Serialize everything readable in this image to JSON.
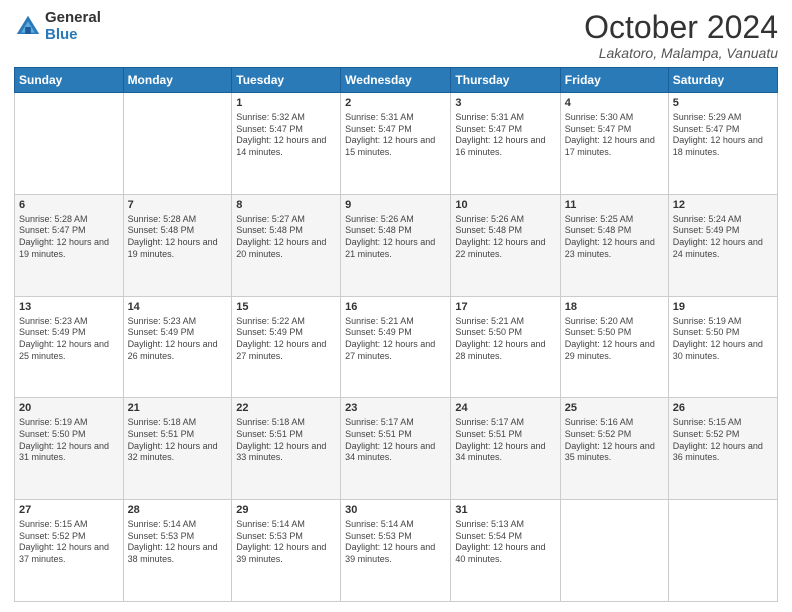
{
  "logo": {
    "general": "General",
    "blue": "Blue"
  },
  "title": "October 2024",
  "subtitle": "Lakatoro, Malampa, Vanuatu",
  "days_header": [
    "Sunday",
    "Monday",
    "Tuesday",
    "Wednesday",
    "Thursday",
    "Friday",
    "Saturday"
  ],
  "weeks": [
    [
      {
        "day": "",
        "sunrise": "",
        "sunset": "",
        "daylight": ""
      },
      {
        "day": "",
        "sunrise": "",
        "sunset": "",
        "daylight": ""
      },
      {
        "day": "1",
        "sunrise": "Sunrise: 5:32 AM",
        "sunset": "Sunset: 5:47 PM",
        "daylight": "Daylight: 12 hours and 14 minutes."
      },
      {
        "day": "2",
        "sunrise": "Sunrise: 5:31 AM",
        "sunset": "Sunset: 5:47 PM",
        "daylight": "Daylight: 12 hours and 15 minutes."
      },
      {
        "day": "3",
        "sunrise": "Sunrise: 5:31 AM",
        "sunset": "Sunset: 5:47 PM",
        "daylight": "Daylight: 12 hours and 16 minutes."
      },
      {
        "day": "4",
        "sunrise": "Sunrise: 5:30 AM",
        "sunset": "Sunset: 5:47 PM",
        "daylight": "Daylight: 12 hours and 17 minutes."
      },
      {
        "day": "5",
        "sunrise": "Sunrise: 5:29 AM",
        "sunset": "Sunset: 5:47 PM",
        "daylight": "Daylight: 12 hours and 18 minutes."
      }
    ],
    [
      {
        "day": "6",
        "sunrise": "Sunrise: 5:28 AM",
        "sunset": "Sunset: 5:47 PM",
        "daylight": "Daylight: 12 hours and 19 minutes."
      },
      {
        "day": "7",
        "sunrise": "Sunrise: 5:28 AM",
        "sunset": "Sunset: 5:48 PM",
        "daylight": "Daylight: 12 hours and 19 minutes."
      },
      {
        "day": "8",
        "sunrise": "Sunrise: 5:27 AM",
        "sunset": "Sunset: 5:48 PM",
        "daylight": "Daylight: 12 hours and 20 minutes."
      },
      {
        "day": "9",
        "sunrise": "Sunrise: 5:26 AM",
        "sunset": "Sunset: 5:48 PM",
        "daylight": "Daylight: 12 hours and 21 minutes."
      },
      {
        "day": "10",
        "sunrise": "Sunrise: 5:26 AM",
        "sunset": "Sunset: 5:48 PM",
        "daylight": "Daylight: 12 hours and 22 minutes."
      },
      {
        "day": "11",
        "sunrise": "Sunrise: 5:25 AM",
        "sunset": "Sunset: 5:48 PM",
        "daylight": "Daylight: 12 hours and 23 minutes."
      },
      {
        "day": "12",
        "sunrise": "Sunrise: 5:24 AM",
        "sunset": "Sunset: 5:49 PM",
        "daylight": "Daylight: 12 hours and 24 minutes."
      }
    ],
    [
      {
        "day": "13",
        "sunrise": "Sunrise: 5:23 AM",
        "sunset": "Sunset: 5:49 PM",
        "daylight": "Daylight: 12 hours and 25 minutes."
      },
      {
        "day": "14",
        "sunrise": "Sunrise: 5:23 AM",
        "sunset": "Sunset: 5:49 PM",
        "daylight": "Daylight: 12 hours and 26 minutes."
      },
      {
        "day": "15",
        "sunrise": "Sunrise: 5:22 AM",
        "sunset": "Sunset: 5:49 PM",
        "daylight": "Daylight: 12 hours and 27 minutes."
      },
      {
        "day": "16",
        "sunrise": "Sunrise: 5:21 AM",
        "sunset": "Sunset: 5:49 PM",
        "daylight": "Daylight: 12 hours and 27 minutes."
      },
      {
        "day": "17",
        "sunrise": "Sunrise: 5:21 AM",
        "sunset": "Sunset: 5:50 PM",
        "daylight": "Daylight: 12 hours and 28 minutes."
      },
      {
        "day": "18",
        "sunrise": "Sunrise: 5:20 AM",
        "sunset": "Sunset: 5:50 PM",
        "daylight": "Daylight: 12 hours and 29 minutes."
      },
      {
        "day": "19",
        "sunrise": "Sunrise: 5:19 AM",
        "sunset": "Sunset: 5:50 PM",
        "daylight": "Daylight: 12 hours and 30 minutes."
      }
    ],
    [
      {
        "day": "20",
        "sunrise": "Sunrise: 5:19 AM",
        "sunset": "Sunset: 5:50 PM",
        "daylight": "Daylight: 12 hours and 31 minutes."
      },
      {
        "day": "21",
        "sunrise": "Sunrise: 5:18 AM",
        "sunset": "Sunset: 5:51 PM",
        "daylight": "Daylight: 12 hours and 32 minutes."
      },
      {
        "day": "22",
        "sunrise": "Sunrise: 5:18 AM",
        "sunset": "Sunset: 5:51 PM",
        "daylight": "Daylight: 12 hours and 33 minutes."
      },
      {
        "day": "23",
        "sunrise": "Sunrise: 5:17 AM",
        "sunset": "Sunset: 5:51 PM",
        "daylight": "Daylight: 12 hours and 34 minutes."
      },
      {
        "day": "24",
        "sunrise": "Sunrise: 5:17 AM",
        "sunset": "Sunset: 5:51 PM",
        "daylight": "Daylight: 12 hours and 34 minutes."
      },
      {
        "day": "25",
        "sunrise": "Sunrise: 5:16 AM",
        "sunset": "Sunset: 5:52 PM",
        "daylight": "Daylight: 12 hours and 35 minutes."
      },
      {
        "day": "26",
        "sunrise": "Sunrise: 5:15 AM",
        "sunset": "Sunset: 5:52 PM",
        "daylight": "Daylight: 12 hours and 36 minutes."
      }
    ],
    [
      {
        "day": "27",
        "sunrise": "Sunrise: 5:15 AM",
        "sunset": "Sunset: 5:52 PM",
        "daylight": "Daylight: 12 hours and 37 minutes."
      },
      {
        "day": "28",
        "sunrise": "Sunrise: 5:14 AM",
        "sunset": "Sunset: 5:53 PM",
        "daylight": "Daylight: 12 hours and 38 minutes."
      },
      {
        "day": "29",
        "sunrise": "Sunrise: 5:14 AM",
        "sunset": "Sunset: 5:53 PM",
        "daylight": "Daylight: 12 hours and 39 minutes."
      },
      {
        "day": "30",
        "sunrise": "Sunrise: 5:14 AM",
        "sunset": "Sunset: 5:53 PM",
        "daylight": "Daylight: 12 hours and 39 minutes."
      },
      {
        "day": "31",
        "sunrise": "Sunrise: 5:13 AM",
        "sunset": "Sunset: 5:54 PM",
        "daylight": "Daylight: 12 hours and 40 minutes."
      },
      {
        "day": "",
        "sunrise": "",
        "sunset": "",
        "daylight": ""
      },
      {
        "day": "",
        "sunrise": "",
        "sunset": "",
        "daylight": ""
      }
    ]
  ]
}
